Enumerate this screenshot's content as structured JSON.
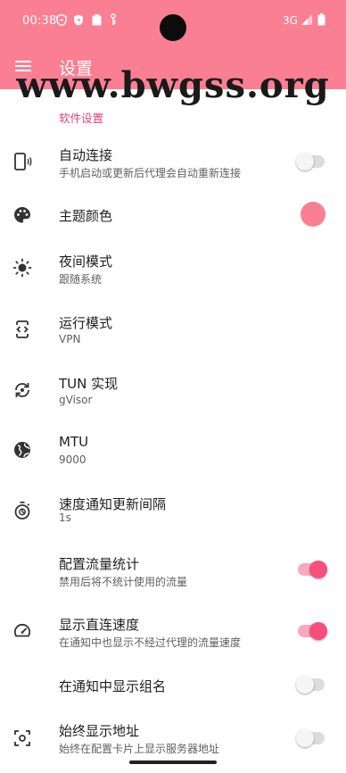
{
  "status_bar": {
    "time": "00:38",
    "network": "3G",
    "icons": [
      "shield-icon",
      "security-icon",
      "clipboard-icon",
      "vpn-key-icon",
      "signal-icon",
      "battery-icon"
    ]
  },
  "app_bar": {
    "title": "设置",
    "menu_icon": "menu-icon",
    "color": "#fb7f93"
  },
  "watermark": "www.bwgss.org",
  "section": {
    "title": "软件设置",
    "accent": "#e0447a"
  },
  "settings": [
    {
      "id": "auto-connect",
      "icon": "phone-vibrate-icon",
      "title": "自动连接",
      "subtitle": "手机启动或更新后代理会自动重新连接",
      "control": "switch",
      "checked": false
    },
    {
      "id": "theme-color",
      "icon": "palette-icon",
      "title": "主题颜色",
      "subtitle": "",
      "control": "color",
      "color": "#fb7f93"
    },
    {
      "id": "night-mode",
      "icon": "brightness-icon",
      "title": "夜间模式",
      "subtitle": "跟随系统",
      "control": "none"
    },
    {
      "id": "run-mode",
      "icon": "code-phone-icon",
      "title": "运行模式",
      "subtitle": "VPN",
      "control": "none"
    },
    {
      "id": "tun-impl",
      "icon": "sync-icon",
      "title": "TUN 实现",
      "subtitle": "gVisor",
      "control": "none"
    },
    {
      "id": "mtu",
      "icon": "globe-icon",
      "title": "MTU",
      "subtitle": "9000",
      "control": "none"
    },
    {
      "id": "speed-interval",
      "icon": "timer-icon",
      "title": "速度通知更新间隔",
      "subtitle": "1s",
      "control": "none"
    },
    {
      "id": "profile-traffic",
      "icon": "",
      "title": "配置流量统计",
      "subtitle": "禁用后将不统计使用的流量",
      "control": "switch",
      "checked": true
    },
    {
      "id": "direct-speed",
      "icon": "speedometer-icon",
      "title": "显示直连速度",
      "subtitle": "在通知中也显示不经过代理的流量速度",
      "control": "switch",
      "checked": true
    },
    {
      "id": "group-name",
      "icon": "",
      "title": "在通知中显示组名",
      "subtitle": "",
      "control": "switch",
      "checked": false
    },
    {
      "id": "show-address",
      "icon": "scan-address-icon",
      "title": "始终显示地址",
      "subtitle": "始终在配置卡片上显示服务器地址",
      "control": "switch",
      "checked": false
    }
  ]
}
